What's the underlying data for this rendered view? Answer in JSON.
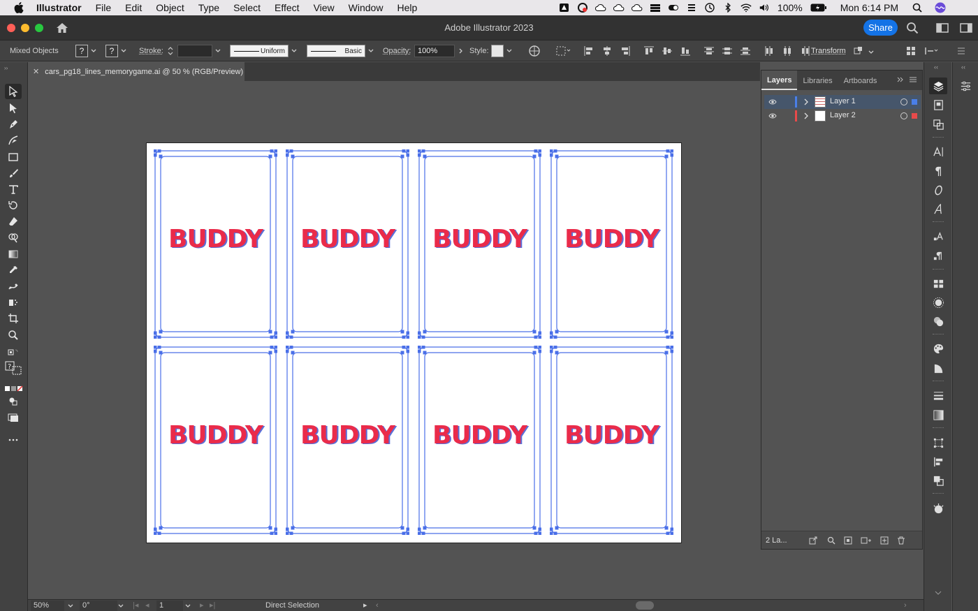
{
  "menubar": {
    "app_name": "Illustrator",
    "items": [
      "File",
      "Edit",
      "Object",
      "Type",
      "Select",
      "Effect",
      "View",
      "Window",
      "Help"
    ],
    "battery": "100%",
    "clock": "Mon 6:14 PM"
  },
  "titlebar": {
    "title": "Adobe Illustrator 2023",
    "share_label": "Share"
  },
  "controlbar": {
    "selection_label": "Mixed Objects",
    "fill_q": "?",
    "stroke_q": "?",
    "stroke_label": "Stroke:",
    "stroke_profile": "Uniform",
    "brush": "Basic",
    "opacity_label": "Opacity:",
    "opacity_value": "100%",
    "style_label": "Style:",
    "transform_label": "Transform"
  },
  "document": {
    "tab_title": "cars_pg18_lines_memorygame.ai @ 50 % (RGB/Preview)",
    "card_word": "BUDDY",
    "card_count": 8
  },
  "layers_panel": {
    "tabs": [
      "Layers",
      "Libraries",
      "Artboards"
    ],
    "active_tab": "Layers",
    "layers": [
      {
        "name": "Layer 1",
        "color": "#4a7fe8",
        "selected": true
      },
      {
        "name": "Layer 2",
        "color": "#e84a4a",
        "selected": false
      }
    ],
    "count_label": "2 La..."
  },
  "statusbar": {
    "zoom": "50%",
    "rotation": "0°",
    "artboard_num": "1",
    "tool_name": "Direct Selection"
  },
  "colors": {
    "accent": "#1473e6",
    "selection_blue": "#4a6fe8",
    "buddy_red": "#ea2b4a"
  }
}
